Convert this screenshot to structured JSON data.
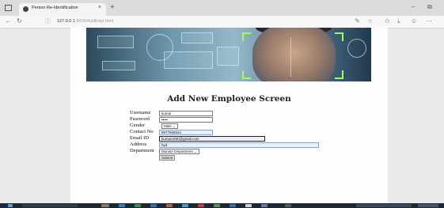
{
  "browser": {
    "tab_title": "Person Re-Identification",
    "tab_close": "×",
    "new_tab": "+",
    "url_host": "127.0.0.1",
    "url_path": ":8000/AddEmp.html",
    "minimize": "–",
    "restore": "⧉"
  },
  "page": {
    "heading": "Add New Employee Screen"
  },
  "form": {
    "username_label": "Username",
    "username_value": "kumar",
    "password_label": "Password",
    "password_value": "•••••",
    "gender_label": "Gender",
    "gender_value": "Male",
    "contact_label": "Contact No",
    "contact_value": "8977665544",
    "email_label": "Email ID",
    "email_value": "kumar1990@gmail.com",
    "address_label": "Address",
    "address_value": "hyd",
    "department_label": "Department",
    "department_value": "Monitor Department",
    "submit_label": "Submit"
  },
  "colors": {
    "autofill_blue": "#e8f0fe",
    "page_bg": "#fdfdfd",
    "outer_bg": "#e9e9e9",
    "scan_green": "#9cff55"
  }
}
